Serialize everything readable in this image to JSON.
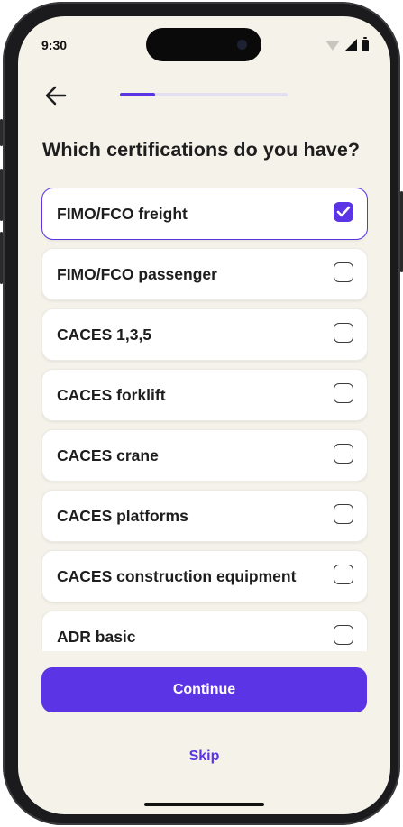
{
  "status_bar": {
    "time": "9:30"
  },
  "progress": {
    "fraction": 0.21
  },
  "title": "Which certifications do you have?",
  "options": [
    {
      "label": "FIMO/FCO freight",
      "selected": true
    },
    {
      "label": "FIMO/FCO passenger",
      "selected": false
    },
    {
      "label": "CACES 1,3,5",
      "selected": false
    },
    {
      "label": "CACES forklift",
      "selected": false
    },
    {
      "label": "CACES crane",
      "selected": false
    },
    {
      "label": "CACES platforms",
      "selected": false
    },
    {
      "label": "CACES construction equipment",
      "selected": false
    },
    {
      "label": "ADR basic",
      "selected": false
    }
  ],
  "continue_label": "Continue",
  "skip_label": "Skip",
  "icons": {
    "back": "arrow-left-icon",
    "check": "check-icon"
  },
  "colors": {
    "accent": "#5b34e6",
    "background": "#f5f2ea"
  }
}
